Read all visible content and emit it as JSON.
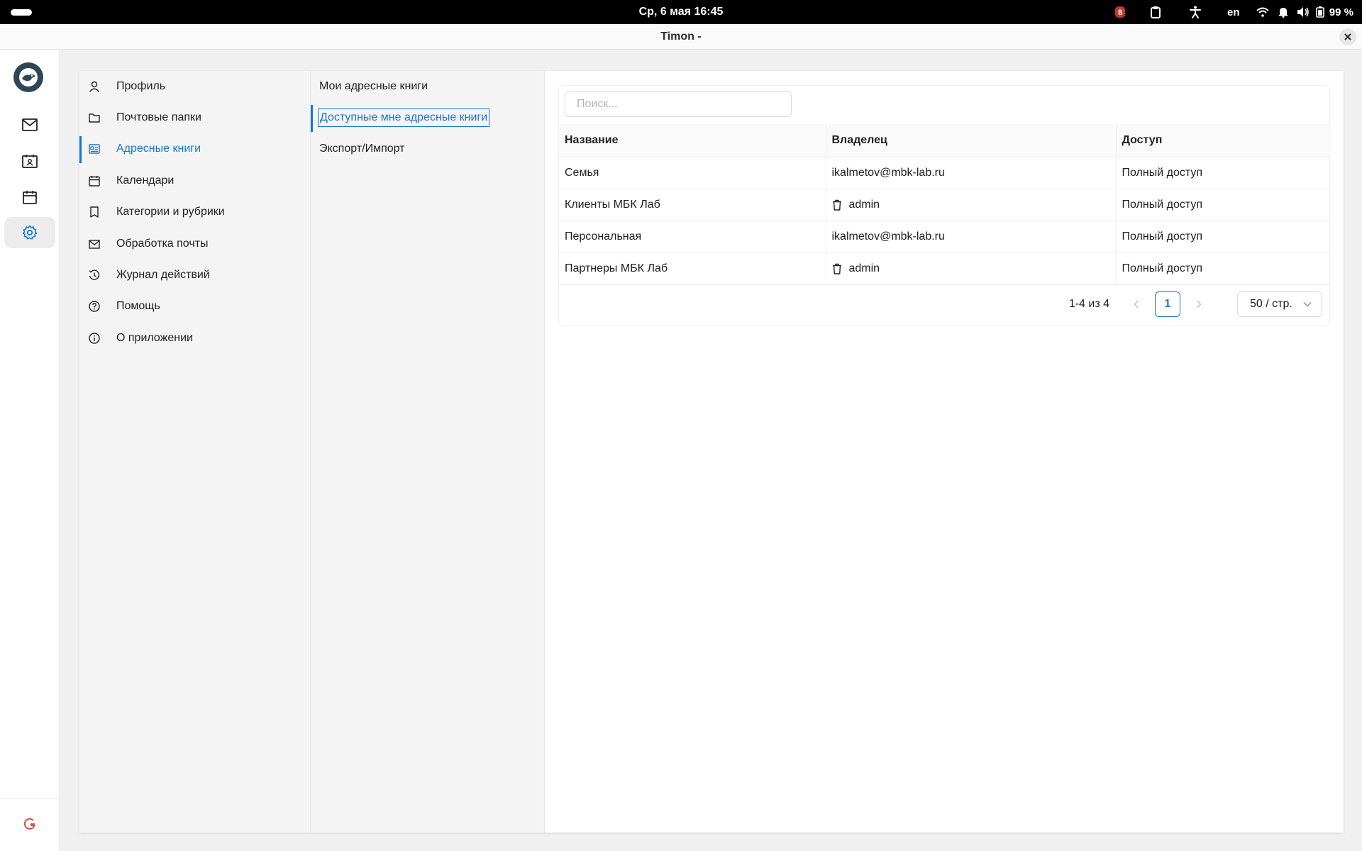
{
  "system_bar": {
    "datetime": "Ср, 6 мая  16:45",
    "keyboard_layout": "en",
    "battery": "99 %"
  },
  "window": {
    "title": "Timon -"
  },
  "rail": {
    "items": [
      {
        "icon": "mail-icon"
      },
      {
        "icon": "contacts-icon"
      },
      {
        "icon": "calendar-icon"
      },
      {
        "icon": "gear-icon",
        "active": true
      }
    ]
  },
  "settings_nav": {
    "items": [
      {
        "label": "Профиль",
        "icon": "user-icon"
      },
      {
        "label": "Почтовые папки",
        "icon": "folder-icon"
      },
      {
        "label": "Адресные книги",
        "icon": "address-book-icon",
        "active": true
      },
      {
        "label": "Календари",
        "icon": "calendar-icon"
      },
      {
        "label": "Категории и рубрики",
        "icon": "bookmark-icon"
      },
      {
        "label": "Обработка почты",
        "icon": "mail-icon"
      },
      {
        "label": "Журнал действий",
        "icon": "history-icon"
      },
      {
        "label": "Помощь",
        "icon": "help-icon"
      },
      {
        "label": "О приложении",
        "icon": "info-icon"
      }
    ]
  },
  "sub_nav": {
    "items": [
      {
        "label": "Мои адресные книги"
      },
      {
        "label": "Доступные мне адресные книги",
        "active": true
      },
      {
        "label": "Экспорт/Импорт"
      }
    ]
  },
  "table": {
    "search_placeholder": "Поиск...",
    "columns": [
      "Название",
      "Владелец",
      "Доступ"
    ],
    "rows": [
      {
        "name": "Семья",
        "owner": "ikalmetov@mbk-lab.ru",
        "owner_icon": false,
        "access": "Полный доступ"
      },
      {
        "name": "Клиенты МБК Лаб",
        "owner": "admin",
        "owner_icon": true,
        "access": "Полный доступ"
      },
      {
        "name": "Персональная",
        "owner": "ikalmetov@mbk-lab.ru",
        "owner_icon": false,
        "access": "Полный доступ"
      },
      {
        "name": "Партнеры МБК Лаб",
        "owner": "admin",
        "owner_icon": true,
        "access": "Полный доступ"
      }
    ]
  },
  "pagination": {
    "total": "1-4 из 4",
    "current_page": "1",
    "page_size": "50 / стр."
  },
  "colors": {
    "accent": "#1677d2",
    "logout": "#e53935"
  }
}
